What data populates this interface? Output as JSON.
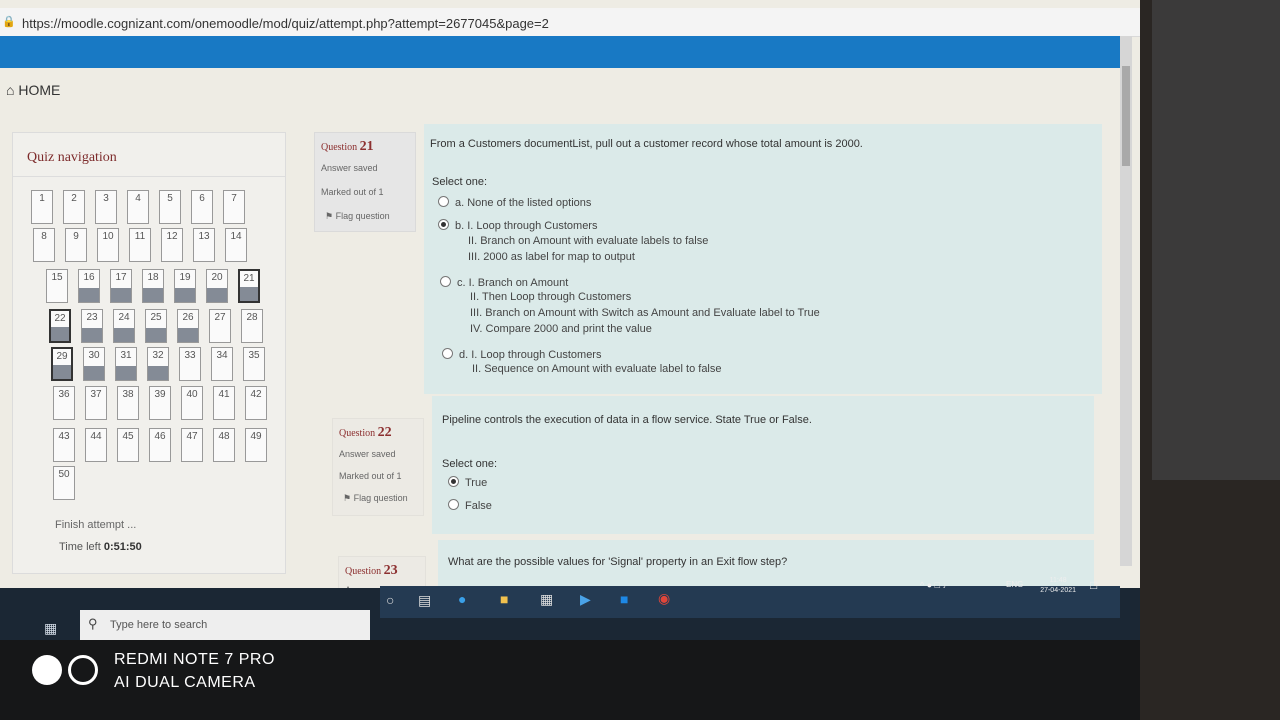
{
  "browser": {
    "url": "https://moodle.cognizant.com/onemoodle/mod/quiz/attempt.php?attempt=2677045&page=2"
  },
  "breadcrumb": {
    "home": "HOME"
  },
  "quiz_nav": {
    "title": "Quiz navigation",
    "finish": "Finish attempt ...",
    "time_label": "Time left",
    "time_value": "0:51:50",
    "buttons": [
      {
        "n": "1",
        "state": "plain"
      },
      {
        "n": "2",
        "state": "plain"
      },
      {
        "n": "3",
        "state": "plain"
      },
      {
        "n": "4",
        "state": "plain"
      },
      {
        "n": "5",
        "state": "plain"
      },
      {
        "n": "6",
        "state": "plain"
      },
      {
        "n": "7",
        "state": "plain"
      },
      {
        "n": "8",
        "state": "plain"
      },
      {
        "n": "9",
        "state": "plain"
      },
      {
        "n": "10",
        "state": "plain"
      },
      {
        "n": "11",
        "state": "plain"
      },
      {
        "n": "12",
        "state": "plain"
      },
      {
        "n": "13",
        "state": "plain"
      },
      {
        "n": "14",
        "state": "plain"
      },
      {
        "n": "15",
        "state": "plain"
      },
      {
        "n": "16",
        "state": "answered"
      },
      {
        "n": "17",
        "state": "answered"
      },
      {
        "n": "18",
        "state": "answered"
      },
      {
        "n": "19",
        "state": "answered"
      },
      {
        "n": "20",
        "state": "answered"
      },
      {
        "n": "21",
        "state": "current"
      },
      {
        "n": "22",
        "state": "current"
      },
      {
        "n": "23",
        "state": "answered"
      },
      {
        "n": "24",
        "state": "answered"
      },
      {
        "n": "25",
        "state": "answered"
      },
      {
        "n": "26",
        "state": "answered"
      },
      {
        "n": "27",
        "state": "plain"
      },
      {
        "n": "28",
        "state": "plain"
      },
      {
        "n": "29",
        "state": "current"
      },
      {
        "n": "30",
        "state": "answered"
      },
      {
        "n": "31",
        "state": "answered"
      },
      {
        "n": "32",
        "state": "answered"
      },
      {
        "n": "33",
        "state": "plain"
      },
      {
        "n": "34",
        "state": "plain"
      },
      {
        "n": "35",
        "state": "plain"
      },
      {
        "n": "36",
        "state": "plain"
      },
      {
        "n": "37",
        "state": "plain"
      },
      {
        "n": "38",
        "state": "plain"
      },
      {
        "n": "39",
        "state": "plain"
      },
      {
        "n": "40",
        "state": "plain"
      },
      {
        "n": "41",
        "state": "plain"
      },
      {
        "n": "42",
        "state": "plain"
      },
      {
        "n": "43",
        "state": "plain"
      },
      {
        "n": "44",
        "state": "plain"
      },
      {
        "n": "45",
        "state": "plain"
      },
      {
        "n": "46",
        "state": "plain"
      },
      {
        "n": "47",
        "state": "plain"
      },
      {
        "n": "48",
        "state": "plain"
      },
      {
        "n": "49",
        "state": "plain"
      },
      {
        "n": "50",
        "state": "plain"
      }
    ]
  },
  "q21": {
    "label": "Question",
    "number": "21",
    "status": "Answer saved",
    "marks": "Marked out of 1",
    "flag": "Flag question",
    "text": "From a Customers documentList, pull out a customer record whose total amount is 2000.",
    "select": "Select one:",
    "opt_a": "a. None of the listed options",
    "opt_b1": "b. I. Loop through Customers",
    "opt_b2": "II. Branch on Amount with evaluate labels to false",
    "opt_b3": "III. 2000 as label for map to output",
    "opt_c1": "c. I. Branch on Amount",
    "opt_c2": "II. Then Loop through Customers",
    "opt_c3": "III. Branch on Amount with Switch as Amount and Evaluate label to True",
    "opt_c4": "IV. Compare 2000 and print the value",
    "opt_d1": "d. I. Loop through Customers",
    "opt_d2": "II. Sequence on Amount with evaluate label to false"
  },
  "q22": {
    "label": "Question",
    "number": "22",
    "status": "Answer saved",
    "marks": "Marked out of 1",
    "flag": "Flag question",
    "text": "Pipeline controls the execution of data in a flow service. State True or False.",
    "select": "Select one:",
    "opt_true": "True",
    "opt_false": "False"
  },
  "q23": {
    "label": "Question",
    "number": "23",
    "status": "Answer saved",
    "text": "What are the possible values for 'Signal' property in an Exit flow step?"
  },
  "taskbar": {
    "search_placeholder": "Type here to search",
    "lang": "ENG",
    "time": "11:48",
    "date": "27-04-2021"
  },
  "camera": {
    "line1": "REDMI NOTE 7 PRO",
    "line2": "AI DUAL CAMERA"
  },
  "colors": {
    "accent_blue": "#1879c4",
    "question_red": "#8c2f2f",
    "content_bg": "#dbeae9"
  }
}
